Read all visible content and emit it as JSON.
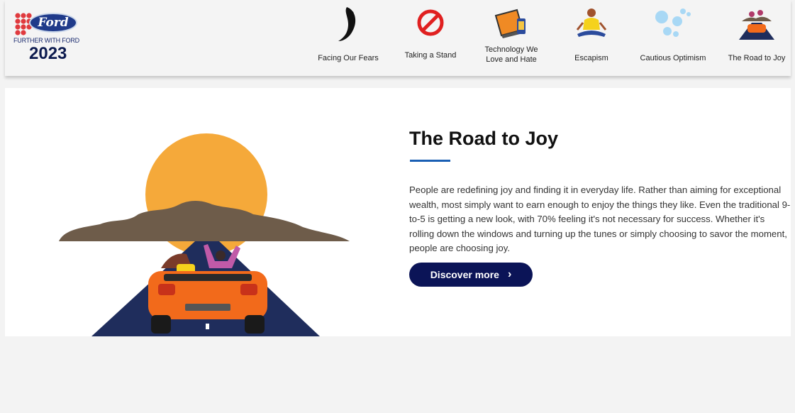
{
  "logo": {
    "wordmark": "Ford",
    "tagline": "FURTHER WITH FORD",
    "year": "2023",
    "dot_color": "#e03a3e",
    "oval_color": "#1f3a8a"
  },
  "nav": {
    "items": [
      {
        "label_line1": "Facing Our Fears",
        "label_line2": "",
        "icon": "moon-figure-icon"
      },
      {
        "label_line1": "Taking a Stand",
        "label_line2": "",
        "icon": "prohibition-sign-icon"
      },
      {
        "label_line1": "Technology We",
        "label_line2": "Love and Hate",
        "icon": "laptop-phone-icon"
      },
      {
        "label_line1": "Escapism",
        "label_line2": "",
        "icon": "meditating-person-icon"
      },
      {
        "label_line1": "Cautious Optimism",
        "label_line2": "",
        "icon": "bubbles-icon"
      },
      {
        "label_line1": "The Road to Joy",
        "label_line2": "",
        "icon": "car-on-road-icon"
      }
    ]
  },
  "main": {
    "title": "The Road to Joy",
    "body": "People are redefining joy and finding it in everyday life. Rather than aiming for exceptional wealth, most simply want to earn enough to enjoy the things they like. Even the traditional 9-to-5 is getting a new look, with 70% feeling it's not necessary for success. Whether it's rolling down the windows and turning up the tunes or simply choosing to savor the moment, people are choosing joy.",
    "cta_label": "Discover more",
    "cta_arrow": "›"
  },
  "colors": {
    "accent_rule": "#1a5fb4",
    "cta_bg": "#0b1457",
    "sun": "#f5a93a",
    "car": "#f26a1b",
    "road": "#1f2d5c",
    "mountain": "#6e5c4a"
  }
}
